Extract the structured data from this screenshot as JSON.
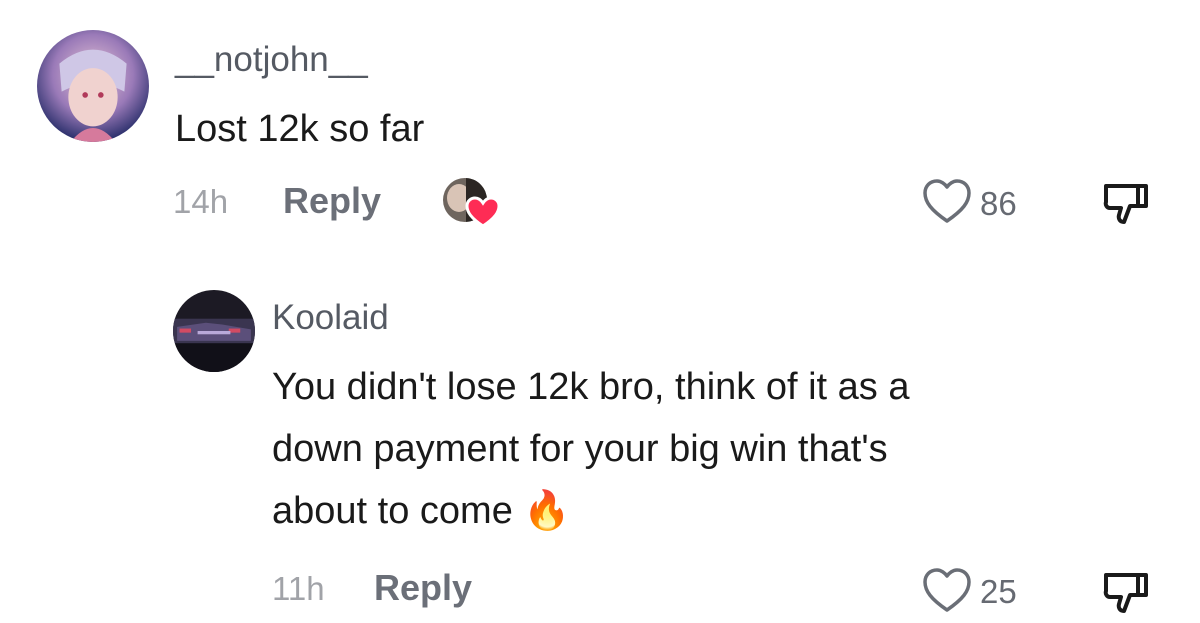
{
  "comments": [
    {
      "username": "__notjohn__",
      "text": "Lost 12k so far",
      "time": "14h",
      "reply_label": "Reply",
      "likes": "86"
    },
    {
      "username": "Koolaid",
      "text_lines": [
        "You didn't lose 12k bro, think of it as a",
        "down payment for your big win that's",
        "about to come"
      ],
      "emoji": "🔥",
      "time": "11h",
      "reply_label": "Reply",
      "likes": "25"
    }
  ],
  "icons": {
    "like": "heart-outline-icon",
    "dislike": "thumbs-down-icon",
    "creator_like": "creator-liked-badge",
    "heart_color": "#fe2c55"
  }
}
